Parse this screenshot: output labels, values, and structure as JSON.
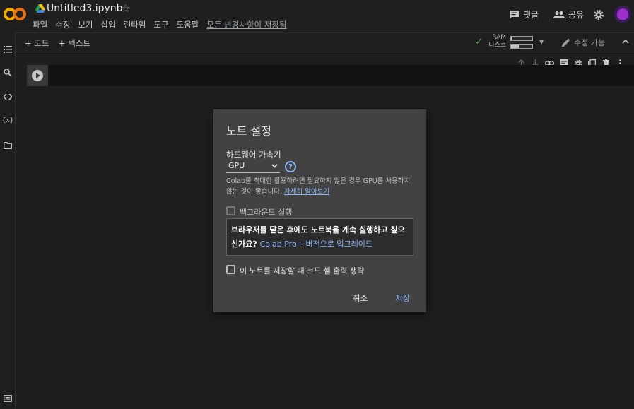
{
  "header": {
    "title": "Untitled3.ipynb",
    "logo_text": "CO",
    "menu": [
      "파일",
      "수정",
      "보기",
      "삽입",
      "런타임",
      "도구",
      "도움말"
    ],
    "saved_status": "모든 변경사항이 저장됨",
    "comment_label": "댓글",
    "share_label": "공유"
  },
  "toolbar": {
    "add_code": "+ 코드",
    "add_text": "+ 텍스트",
    "ram_label": "RAM",
    "disk_label": "디스크",
    "ram_usage": 0.05,
    "disk_usage": 0.35,
    "edit_mode": "수정 가능"
  },
  "dialog": {
    "title": "노트 설정",
    "hardware_label": "하드웨어 가속기",
    "hardware_value": "GPU",
    "help_symbol": "?",
    "description": "Colab를 최대한 활용하려면 필요하지 않은 경우 GPU를 사용하지 않는 것이 좋습니다.",
    "learn_more": "자세히 알아보기",
    "background_label": "백그라운드 실행",
    "promo_text": "브라우저를 닫은 후에도 노트북을 계속 실행하고 싶으신가요?",
    "promo_link": "Colab Pro+ 버전으로 업그레이드",
    "omit_output_label": "이 노트를 저장할 때 코드 셀 출력 생략",
    "cancel_label": "취소",
    "save_label": "저장"
  },
  "colors": {
    "accent": "#8ab4f8",
    "background": "#1e1e1e",
    "dialog": "#424242"
  }
}
